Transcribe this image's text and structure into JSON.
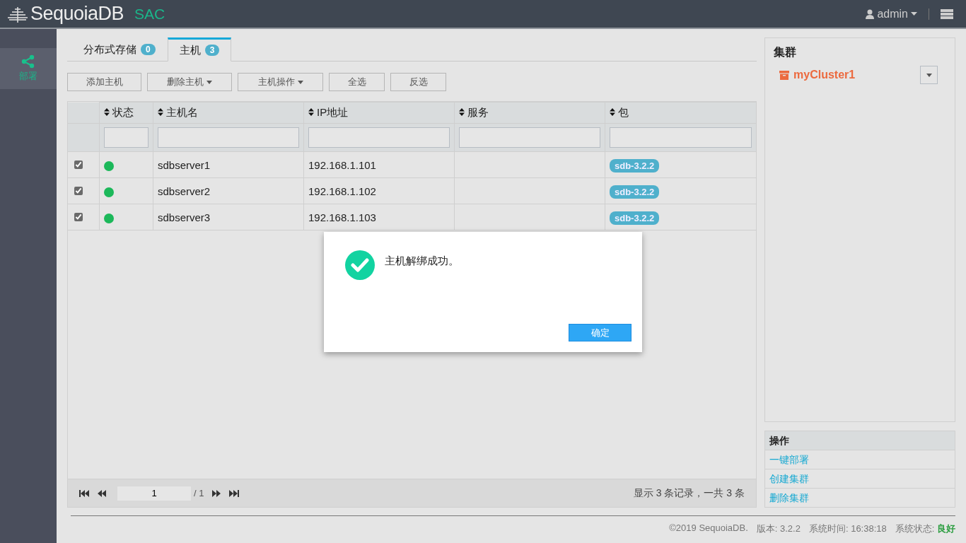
{
  "header": {
    "logo": "SequoiaDB",
    "product": "SAC",
    "user": "admin"
  },
  "sidebar": {
    "items": [
      {
        "label": "部署",
        "selected": true
      }
    ]
  },
  "tabs": [
    {
      "label": "分布式存储",
      "count": "0",
      "selected": false
    },
    {
      "label": "主机",
      "count": "3",
      "selected": true
    }
  ],
  "toolbar": [
    {
      "label": "添加主机",
      "dropdown": false
    },
    {
      "label": "删除主机",
      "dropdown": true
    },
    {
      "label": "主机操作",
      "dropdown": true
    },
    {
      "label": "全选",
      "dropdown": false
    },
    {
      "label": "反选",
      "dropdown": false
    }
  ],
  "table": {
    "columns": [
      "状态",
      "主机名",
      "IP地址",
      "服务",
      "包"
    ],
    "rows": [
      {
        "checked": true,
        "color": "#1cb85a",
        "hostname": "sdbserver1",
        "ip": "192.168.1.101",
        "package": "sdb-3.2.2"
      },
      {
        "checked": true,
        "color": "#1cb85a",
        "hostname": "sdbserver2",
        "ip": "192.168.1.102",
        "package": "sdb-3.2.2"
      },
      {
        "checked": true,
        "color": "#1cb85a",
        "hostname": "sdbserver3",
        "ip": "192.168.1.103",
        "package": "sdb-3.2.2"
      }
    ]
  },
  "pager": {
    "page": "1",
    "total_pages": "/ 1",
    "summary": "显示 3 条记录，一共 3 条"
  },
  "cluster_panel": {
    "title": "集群",
    "cluster": "myCluster1"
  },
  "operations": {
    "title": "操作",
    "items": [
      "一键部署",
      "创建集群",
      "删除集群"
    ]
  },
  "footer": {
    "copyright": "©2019 SequoiaDB.",
    "version": "版本: 3.2.2",
    "time": "系统时间: 16:38:18",
    "status_label": "系统状态:",
    "status": "良好"
  },
  "dialog": {
    "message": "主机解绑成功。",
    "button": "确定"
  }
}
